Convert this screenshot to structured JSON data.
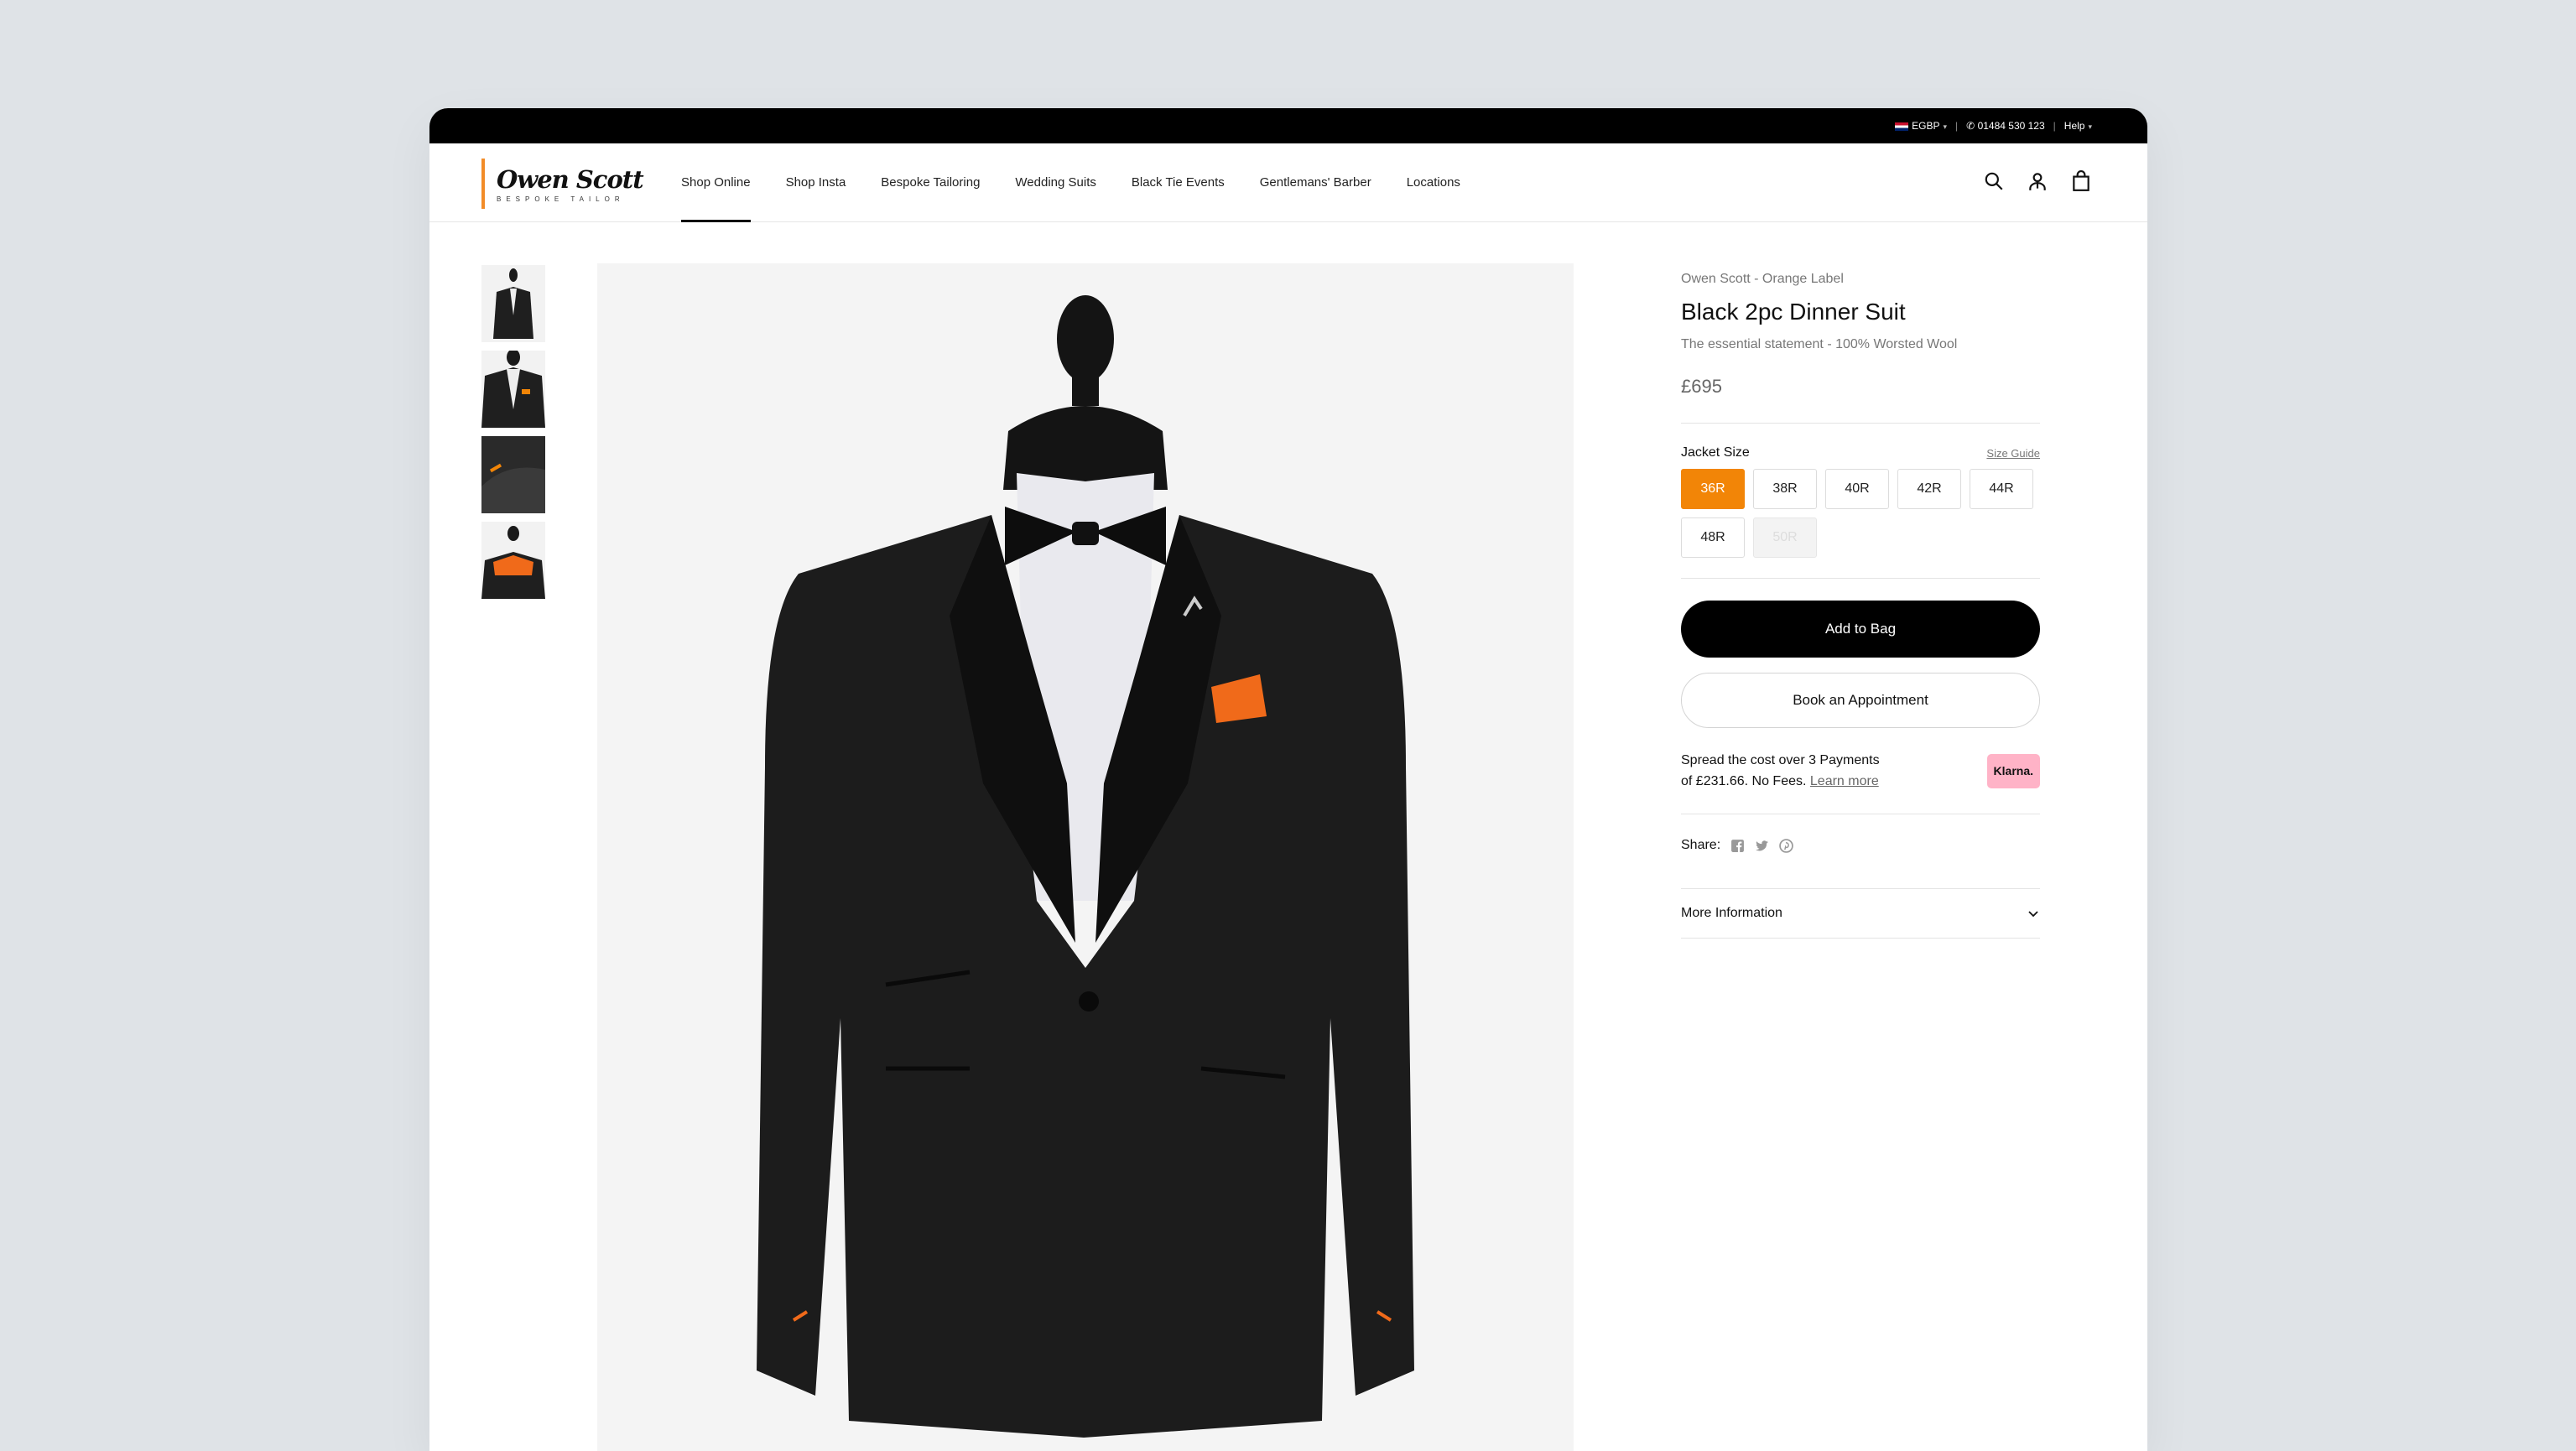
{
  "topbar": {
    "currency": "EGBP",
    "phone": "01484 530 123",
    "help": "Help"
  },
  "brand": {
    "logo_name": "Owen Scott",
    "logo_sub": "BESPOKE TAILOR"
  },
  "nav": {
    "items": [
      {
        "label": "Shop Online",
        "active": true
      },
      {
        "label": "Shop Insta"
      },
      {
        "label": "Bespoke Tailoring"
      },
      {
        "label": "Wedding Suits"
      },
      {
        "label": "Black Tie Events"
      },
      {
        "label": "Gentlemans' Barber"
      },
      {
        "label": "Locations"
      }
    ]
  },
  "header_icons": [
    "search-icon",
    "account-icon",
    "bag-icon"
  ],
  "product": {
    "brand_line": "Owen Scott - Orange Label",
    "title": "Black 2pc Dinner Suit",
    "tagline": "The essential statement - 100% Worsted Wool",
    "price": "£695",
    "size_label": "Jacket Size",
    "size_guide": "Size Guide",
    "sizes": [
      {
        "label": "36R",
        "state": "selected"
      },
      {
        "label": "38R",
        "state": "available"
      },
      {
        "label": "40R",
        "state": "available"
      },
      {
        "label": "42R",
        "state": "available"
      },
      {
        "label": "44R",
        "state": "available"
      },
      {
        "label": "48R",
        "state": "available"
      },
      {
        "label": "50R",
        "state": "unavailable"
      }
    ],
    "add_to_bag": "Add to Bag",
    "book_appointment": "Book an Appointment",
    "klarna_line1": "Spread the cost over 3 Payments",
    "klarna_line2": "of £231.66. No Fees.",
    "klarna_learn": "Learn more",
    "klarna_badge": "Klarna.",
    "share_label": "Share:",
    "more_info": "More Information"
  },
  "colors": {
    "accent": "#f28507",
    "topbar": "#000000",
    "klarna": "#ffb3c7"
  }
}
